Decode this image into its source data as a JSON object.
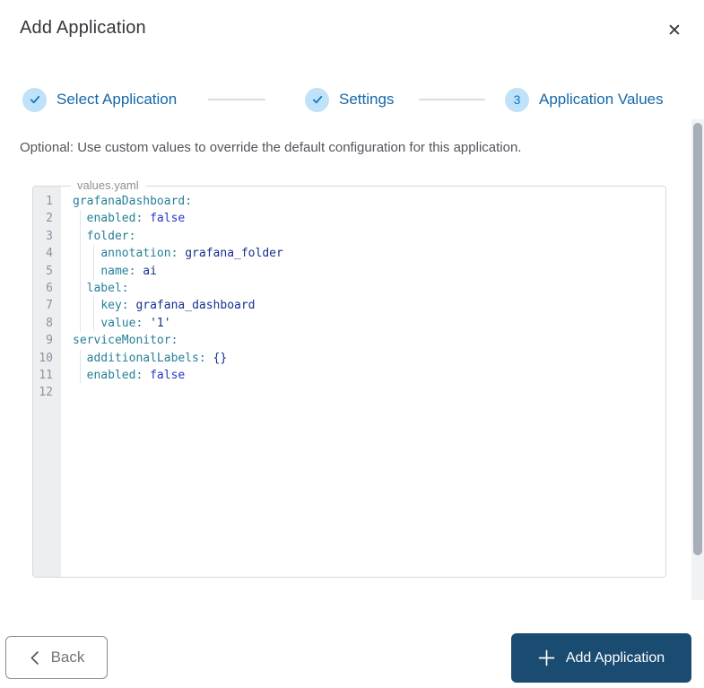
{
  "colors": {
    "step_label_blue": "#1568a9",
    "step_circle_bg": "#bfe2f8",
    "step_icon_blue": "#0a77cc",
    "primary_button_bg": "#1a4b70",
    "code_key_teal": "#267f99",
    "code_value_navy": "#16308e",
    "code_bool_blue": "#2636d2",
    "gutter_bg": "#eceef0"
  },
  "icons": {
    "close": "✕",
    "step_done": "✓",
    "back_chevron": "‹",
    "add_plus": "+"
  },
  "dialog": {
    "title": "Add Application"
  },
  "stepper": {
    "steps": [
      {
        "label": "Select Application",
        "state": "done"
      },
      {
        "label": "Settings",
        "state": "done"
      },
      {
        "label": "Application Values",
        "state": "current",
        "number": "3"
      }
    ]
  },
  "description": "Optional: Use custom values to override the default configuration for this application.",
  "editor": {
    "filename": "values.yaml",
    "language": "yaml",
    "lines": [
      {
        "num": "1",
        "guides": 0,
        "tokens": [
          [
            "key",
            "grafanaDashboard:"
          ]
        ]
      },
      {
        "num": "2",
        "guides": 1,
        "tokens": [
          [
            "plain",
            "  "
          ],
          [
            "key",
            "enabled:"
          ],
          [
            "plain",
            " "
          ],
          [
            "bool",
            "false"
          ]
        ]
      },
      {
        "num": "3",
        "guides": 1,
        "tokens": [
          [
            "plain",
            "  "
          ],
          [
            "key",
            "folder:"
          ]
        ]
      },
      {
        "num": "4",
        "guides": 2,
        "tokens": [
          [
            "plain",
            "    "
          ],
          [
            "key",
            "annotation:"
          ],
          [
            "plain",
            " "
          ],
          [
            "val",
            "grafana_folder"
          ]
        ]
      },
      {
        "num": "5",
        "guides": 2,
        "tokens": [
          [
            "plain",
            "    "
          ],
          [
            "key",
            "name:"
          ],
          [
            "plain",
            " "
          ],
          [
            "val",
            "ai"
          ]
        ]
      },
      {
        "num": "6",
        "guides": 1,
        "tokens": [
          [
            "plain",
            "  "
          ],
          [
            "key",
            "label:"
          ]
        ]
      },
      {
        "num": "7",
        "guides": 2,
        "tokens": [
          [
            "plain",
            "    "
          ],
          [
            "key",
            "key:"
          ],
          [
            "plain",
            " "
          ],
          [
            "val",
            "grafana_dashboard"
          ]
        ]
      },
      {
        "num": "8",
        "guides": 2,
        "tokens": [
          [
            "plain",
            "    "
          ],
          [
            "key",
            "value:"
          ],
          [
            "plain",
            " "
          ],
          [
            "val",
            "'1'"
          ]
        ]
      },
      {
        "num": "9",
        "guides": 0,
        "tokens": [
          [
            "key",
            "serviceMonitor:"
          ]
        ]
      },
      {
        "num": "10",
        "guides": 1,
        "tokens": [
          [
            "plain",
            "  "
          ],
          [
            "key",
            "additionalLabels:"
          ],
          [
            "plain",
            " "
          ],
          [
            "val",
            "{}"
          ]
        ]
      },
      {
        "num": "11",
        "guides": 1,
        "tokens": [
          [
            "plain",
            "  "
          ],
          [
            "key",
            "enabled:"
          ],
          [
            "plain",
            " "
          ],
          [
            "bool",
            "false"
          ]
        ]
      },
      {
        "num": "12",
        "guides": 0,
        "tokens": []
      }
    ]
  },
  "footer": {
    "back_label": "Back",
    "add_label": "Add Application"
  }
}
